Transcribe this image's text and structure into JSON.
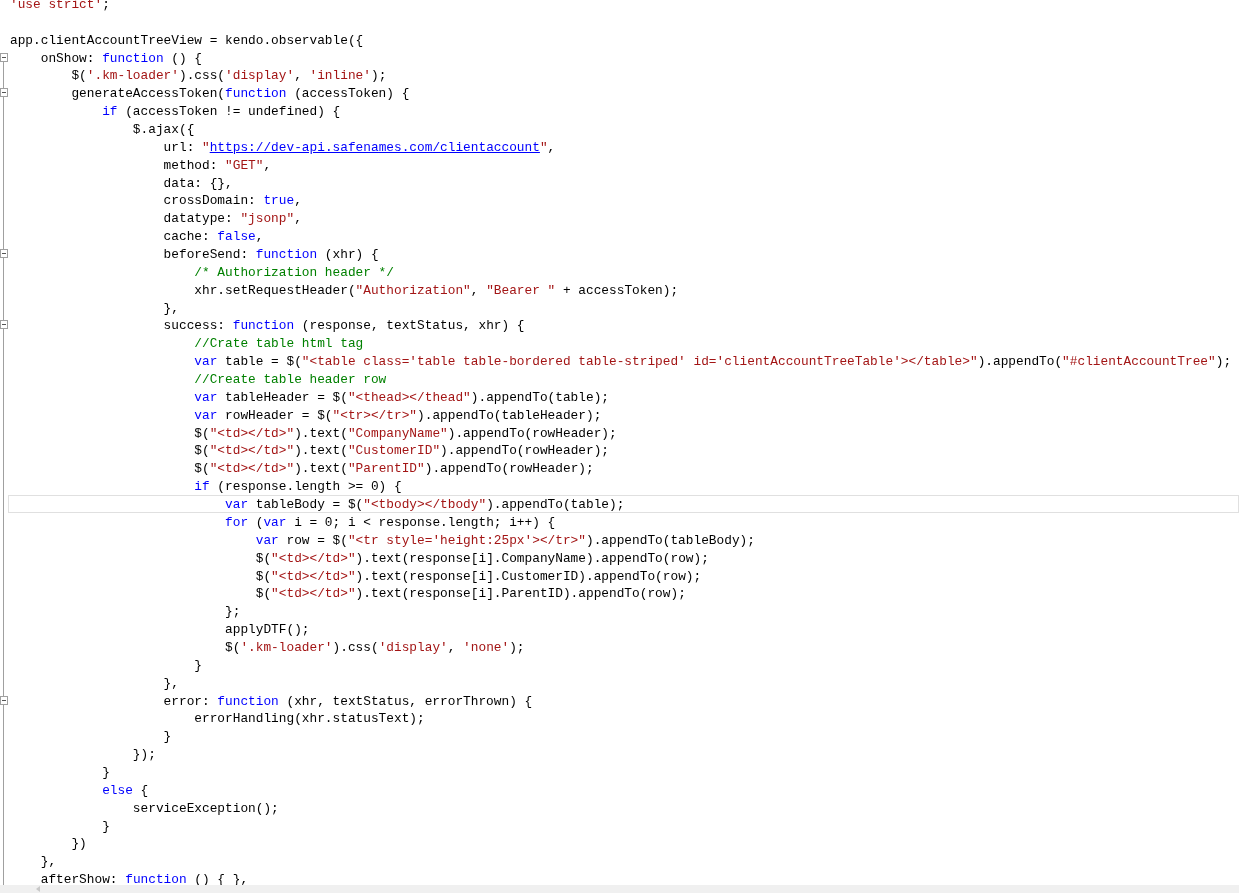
{
  "editor": {
    "lines": [
      {
        "fold": false,
        "current": false,
        "tokens": [
          {
            "kind": "string",
            "text": "'use strict'"
          },
          {
            "kind": "plain",
            "text": ";"
          }
        ]
      },
      {
        "fold": false,
        "current": false
      },
      {
        "fold": false,
        "current": false,
        "tokens": [
          {
            "kind": "plain",
            "text": "app.clientAccountTreeView = kendo.observable({"
          }
        ]
      },
      {
        "fold": true,
        "current": false,
        "tokens": [
          {
            "kind": "plain",
            "text": "    onShow: "
          },
          {
            "kind": "keyword",
            "text": "function"
          },
          {
            "kind": "plain",
            "text": " () {"
          }
        ]
      },
      {
        "fold": false,
        "current": false,
        "tokens": [
          {
            "kind": "plain",
            "text": "        $("
          },
          {
            "kind": "string",
            "text": "'.km-loader'"
          },
          {
            "kind": "plain",
            "text": ").css("
          },
          {
            "kind": "string",
            "text": "'display'"
          },
          {
            "kind": "plain",
            "text": ", "
          },
          {
            "kind": "string",
            "text": "'inline'"
          },
          {
            "kind": "plain",
            "text": ");"
          }
        ]
      },
      {
        "fold": true,
        "current": false,
        "tokens": [
          {
            "kind": "plain",
            "text": "        generateAccessToken("
          },
          {
            "kind": "keyword",
            "text": "function"
          },
          {
            "kind": "plain",
            "text": " (accessToken) {"
          }
        ]
      },
      {
        "fold": false,
        "current": false,
        "tokens": [
          {
            "kind": "keyword",
            "text": "            if"
          },
          {
            "kind": "plain",
            "text": " (accessToken != undefined) {"
          }
        ]
      },
      {
        "fold": false,
        "current": false,
        "tokens": [
          {
            "kind": "plain",
            "text": "                $.ajax({"
          }
        ]
      },
      {
        "fold": false,
        "current": false,
        "tokens": [
          {
            "kind": "plain",
            "text": "                    url: "
          },
          {
            "kind": "string",
            "text": "\""
          },
          {
            "kind": "link",
            "text": "https://dev-api.safenames.com/clientaccount"
          },
          {
            "kind": "string",
            "text": "\""
          },
          {
            "kind": "plain",
            "text": ","
          }
        ]
      },
      {
        "fold": false,
        "current": false,
        "tokens": [
          {
            "kind": "plain",
            "text": "                    method: "
          },
          {
            "kind": "string",
            "text": "\"GET\""
          },
          {
            "kind": "plain",
            "text": ","
          }
        ]
      },
      {
        "fold": false,
        "current": false,
        "tokens": [
          {
            "kind": "plain",
            "text": "                    data: {},"
          }
        ]
      },
      {
        "fold": false,
        "current": false,
        "tokens": [
          {
            "kind": "plain",
            "text": "                    crossDomain: "
          },
          {
            "kind": "keyword",
            "text": "true"
          },
          {
            "kind": "plain",
            "text": ","
          }
        ]
      },
      {
        "fold": false,
        "current": false,
        "tokens": [
          {
            "kind": "plain",
            "text": "                    datatype: "
          },
          {
            "kind": "string",
            "text": "\"jsonp\""
          },
          {
            "kind": "plain",
            "text": ","
          }
        ]
      },
      {
        "fold": false,
        "current": false,
        "tokens": [
          {
            "kind": "plain",
            "text": "                    cache: "
          },
          {
            "kind": "keyword",
            "text": "false"
          },
          {
            "kind": "plain",
            "text": ","
          }
        ]
      },
      {
        "fold": true,
        "current": false,
        "tokens": [
          {
            "kind": "plain",
            "text": "                    beforeSend: "
          },
          {
            "kind": "keyword",
            "text": "function"
          },
          {
            "kind": "plain",
            "text": " (xhr) {"
          }
        ]
      },
      {
        "fold": false,
        "current": false,
        "tokens": [
          {
            "kind": "comment",
            "text": "                        /* Authorization header */"
          }
        ]
      },
      {
        "fold": false,
        "current": false,
        "tokens": [
          {
            "kind": "plain",
            "text": "                        xhr.setRequestHeader("
          },
          {
            "kind": "string",
            "text": "\"Authorization\""
          },
          {
            "kind": "plain",
            "text": ", "
          },
          {
            "kind": "string",
            "text": "\"Bearer \""
          },
          {
            "kind": "plain",
            "text": " + accessToken);"
          }
        ]
      },
      {
        "fold": false,
        "current": false,
        "tokens": [
          {
            "kind": "plain",
            "text": "                    },"
          }
        ]
      },
      {
        "fold": true,
        "current": false,
        "tokens": [
          {
            "kind": "plain",
            "text": "                    success: "
          },
          {
            "kind": "keyword",
            "text": "function"
          },
          {
            "kind": "plain",
            "text": " (response, textStatus, xhr) {"
          }
        ]
      },
      {
        "fold": false,
        "current": false,
        "tokens": [
          {
            "kind": "comment",
            "text": "                        //Crate table html tag"
          }
        ]
      },
      {
        "fold": false,
        "current": false,
        "tokens": [
          {
            "kind": "keyword",
            "text": "                        var"
          },
          {
            "kind": "plain",
            "text": " table = $("
          },
          {
            "kind": "string",
            "text": "\"<table class='table table-bordered table-striped' id='clientAccountTreeTable'></table>\""
          },
          {
            "kind": "plain",
            "text": ").appendTo("
          },
          {
            "kind": "string",
            "text": "\"#clientAccountTree\""
          },
          {
            "kind": "plain",
            "text": ");"
          }
        ]
      },
      {
        "fold": false,
        "current": false,
        "tokens": [
          {
            "kind": "comment",
            "text": "                        //Create table header row"
          }
        ]
      },
      {
        "fold": false,
        "current": false,
        "tokens": [
          {
            "kind": "keyword",
            "text": "                        var"
          },
          {
            "kind": "plain",
            "text": " tableHeader = $("
          },
          {
            "kind": "string",
            "text": "\"<thead></thead\""
          },
          {
            "kind": "plain",
            "text": ").appendTo(table);"
          }
        ]
      },
      {
        "fold": false,
        "current": false,
        "tokens": [
          {
            "kind": "keyword",
            "text": "                        var"
          },
          {
            "kind": "plain",
            "text": " rowHeader = $("
          },
          {
            "kind": "string",
            "text": "\"<tr></tr>\""
          },
          {
            "kind": "plain",
            "text": ").appendTo(tableHeader);"
          }
        ]
      },
      {
        "fold": false,
        "current": false,
        "tokens": [
          {
            "kind": "plain",
            "text": "                        $("
          },
          {
            "kind": "string",
            "text": "\"<td></td>\""
          },
          {
            "kind": "plain",
            "text": ").text("
          },
          {
            "kind": "string",
            "text": "\"CompanyName\""
          },
          {
            "kind": "plain",
            "text": ").appendTo(rowHeader);"
          }
        ]
      },
      {
        "fold": false,
        "current": false,
        "tokens": [
          {
            "kind": "plain",
            "text": "                        $("
          },
          {
            "kind": "string",
            "text": "\"<td></td>\""
          },
          {
            "kind": "plain",
            "text": ").text("
          },
          {
            "kind": "string",
            "text": "\"CustomerID\""
          },
          {
            "kind": "plain",
            "text": ").appendTo(rowHeader);"
          }
        ]
      },
      {
        "fold": false,
        "current": false,
        "tokens": [
          {
            "kind": "plain",
            "text": "                        $("
          },
          {
            "kind": "string",
            "text": "\"<td></td>\""
          },
          {
            "kind": "plain",
            "text": ").text("
          },
          {
            "kind": "string",
            "text": "\"ParentID\""
          },
          {
            "kind": "plain",
            "text": ").appendTo(rowHeader);"
          }
        ]
      },
      {
        "fold": false,
        "current": false,
        "tokens": [
          {
            "kind": "keyword",
            "text": "                        if"
          },
          {
            "kind": "plain",
            "text": " (response.length >= 0) {"
          }
        ]
      },
      {
        "fold": false,
        "current": true,
        "tokens": [
          {
            "kind": "keyword",
            "text": "                            var"
          },
          {
            "kind": "plain",
            "text": " tableBody = $("
          },
          {
            "kind": "string",
            "text": "\"<tbody></tbody\""
          },
          {
            "kind": "plain",
            "text": ").appendTo(table);"
          }
        ]
      },
      {
        "fold": false,
        "current": false,
        "tokens": [
          {
            "kind": "keyword",
            "text": "                            for"
          },
          {
            "kind": "plain",
            "text": " ("
          },
          {
            "kind": "keyword",
            "text": "var"
          },
          {
            "kind": "plain",
            "text": " i = 0; i < response.length; i++) {"
          }
        ]
      },
      {
        "fold": false,
        "current": false,
        "tokens": [
          {
            "kind": "keyword",
            "text": "                                var"
          },
          {
            "kind": "plain",
            "text": " row = $("
          },
          {
            "kind": "string",
            "text": "\"<tr style='height:25px'></tr>\""
          },
          {
            "kind": "plain",
            "text": ").appendTo(tableBody);"
          }
        ]
      },
      {
        "fold": false,
        "current": false,
        "tokens": [
          {
            "kind": "plain",
            "text": "                                $("
          },
          {
            "kind": "string",
            "text": "\"<td></td>\""
          },
          {
            "kind": "plain",
            "text": ").text(response[i].CompanyName).appendTo(row);"
          }
        ]
      },
      {
        "fold": false,
        "current": false,
        "tokens": [
          {
            "kind": "plain",
            "text": "                                $("
          },
          {
            "kind": "string",
            "text": "\"<td></td>\""
          },
          {
            "kind": "plain",
            "text": ").text(response[i].CustomerID).appendTo(row);"
          }
        ]
      },
      {
        "fold": false,
        "current": false,
        "tokens": [
          {
            "kind": "plain",
            "text": "                                $("
          },
          {
            "kind": "string",
            "text": "\"<td></td>\""
          },
          {
            "kind": "plain",
            "text": ").text(response[i].ParentID).appendTo(row);"
          }
        ]
      },
      {
        "fold": false,
        "current": false,
        "tokens": [
          {
            "kind": "plain",
            "text": "                            };"
          }
        ]
      },
      {
        "fold": false,
        "current": false,
        "tokens": [
          {
            "kind": "plain",
            "text": "                            applyDTF();"
          }
        ]
      },
      {
        "fold": false,
        "current": false,
        "tokens": [
          {
            "kind": "plain",
            "text": "                            $("
          },
          {
            "kind": "string",
            "text": "'.km-loader'"
          },
          {
            "kind": "plain",
            "text": ").css("
          },
          {
            "kind": "string",
            "text": "'display'"
          },
          {
            "kind": "plain",
            "text": ", "
          },
          {
            "kind": "string",
            "text": "'none'"
          },
          {
            "kind": "plain",
            "text": ");"
          }
        ]
      },
      {
        "fold": false,
        "current": false,
        "tokens": [
          {
            "kind": "plain",
            "text": "                        }"
          }
        ]
      },
      {
        "fold": false,
        "current": false,
        "tokens": [
          {
            "kind": "plain",
            "text": "                    },"
          }
        ]
      },
      {
        "fold": true,
        "current": false,
        "tokens": [
          {
            "kind": "plain",
            "text": "                    error: "
          },
          {
            "kind": "keyword",
            "text": "function"
          },
          {
            "kind": "plain",
            "text": " (xhr, textStatus, errorThrown) {"
          }
        ]
      },
      {
        "fold": false,
        "current": false,
        "tokens": [
          {
            "kind": "plain",
            "text": "                        errorHandling(xhr.statusText);"
          }
        ]
      },
      {
        "fold": false,
        "current": false,
        "tokens": [
          {
            "kind": "plain",
            "text": "                    }"
          }
        ]
      },
      {
        "fold": false,
        "current": false,
        "tokens": [
          {
            "kind": "plain",
            "text": "                });"
          }
        ]
      },
      {
        "fold": false,
        "current": false,
        "tokens": [
          {
            "kind": "plain",
            "text": "            }"
          }
        ]
      },
      {
        "fold": false,
        "current": false,
        "tokens": [
          {
            "kind": "keyword",
            "text": "            else"
          },
          {
            "kind": "plain",
            "text": " {"
          }
        ]
      },
      {
        "fold": false,
        "current": false,
        "tokens": [
          {
            "kind": "plain",
            "text": "                serviceException();"
          }
        ]
      },
      {
        "fold": false,
        "current": false,
        "tokens": [
          {
            "kind": "plain",
            "text": "            }"
          }
        ]
      },
      {
        "fold": false,
        "current": false,
        "tokens": [
          {
            "kind": "plain",
            "text": "        })"
          }
        ]
      },
      {
        "fold": false,
        "current": false,
        "tokens": [
          {
            "kind": "plain",
            "text": "    },"
          }
        ]
      },
      {
        "fold": false,
        "current": false,
        "tokens": [
          {
            "kind": "plain",
            "text": "    afterShow: "
          },
          {
            "kind": "keyword",
            "text": "function"
          },
          {
            "kind": "plain",
            "text": " () { },"
          }
        ]
      }
    ]
  }
}
